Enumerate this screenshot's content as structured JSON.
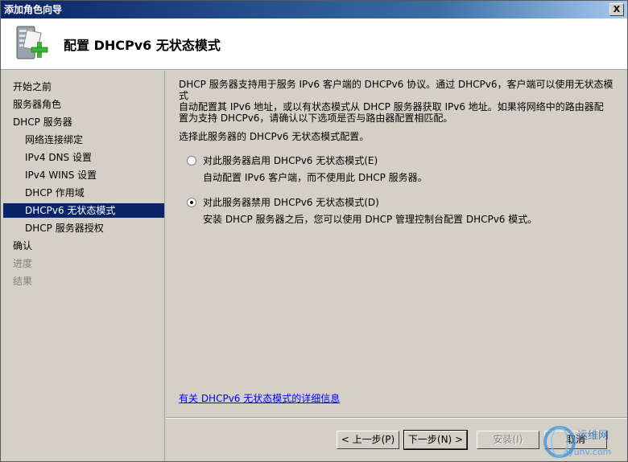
{
  "window": {
    "title": "添加角色向导",
    "close_glyph": "X"
  },
  "header": {
    "title": "配置 DHCPv6 无状态模式",
    "icon": "server-add-icon"
  },
  "sidebar": {
    "items": [
      {
        "label": "开始之前",
        "state": "normal",
        "level": 0
      },
      {
        "label": "服务器角色",
        "state": "normal",
        "level": 0
      },
      {
        "label": "DHCP 服务器",
        "state": "normal",
        "level": 0
      },
      {
        "label": "网络连接绑定",
        "state": "normal",
        "level": 1
      },
      {
        "label": "IPv4 DNS 设置",
        "state": "normal",
        "level": 1
      },
      {
        "label": "IPv4 WINS 设置",
        "state": "normal",
        "level": 1
      },
      {
        "label": "DHCP 作用域",
        "state": "normal",
        "level": 1
      },
      {
        "label": "DHCPv6 无状态模式",
        "state": "active",
        "level": 1
      },
      {
        "label": "DHCP 服务器授权",
        "state": "normal",
        "level": 1
      },
      {
        "label": "确认",
        "state": "normal",
        "level": 0
      },
      {
        "label": "进度",
        "state": "disabled",
        "level": 0
      },
      {
        "label": "结果",
        "state": "disabled",
        "level": 0
      }
    ]
  },
  "main": {
    "description_lines": [
      "DHCP 服务器支持用于服务 IPv6 客户端的 DHCPv6 协议。通过 DHCPv6，客户端可以使用无状态模式",
      "自动配置其 IPv6 地址，或以有状态模式从 DHCP 服务器获取 IPv6 地址。如果将网络中的路由器配",
      "置为支持 DHCPv6，请确认以下选项是否与路由器配置相匹配。"
    ],
    "prompt": "选择此服务器的 DHCPv6 无状态模式配置。",
    "options": [
      {
        "label": "对此服务器启用 DHCPv6 无状态模式(E)",
        "description": "自动配置 IPv6 客户端，而不使用此 DHCP 服务器。",
        "checked": false
      },
      {
        "label": "对此服务器禁用 DHCPv6 无状态模式(D)",
        "description": "安装 DHCP 服务器之后，您可以使用 DHCP 管理控制台配置 DHCPv6 模式。",
        "checked": true
      }
    ],
    "link": "有关 DHCPv6 无状态模式的详细信息"
  },
  "footer": {
    "back": "< 上一步(P)",
    "next": "下一步(N) >",
    "install": "安装(I)",
    "cancel": "取消"
  },
  "watermark": {
    "text": "运维网",
    "subtext": "iyunv.com"
  }
}
